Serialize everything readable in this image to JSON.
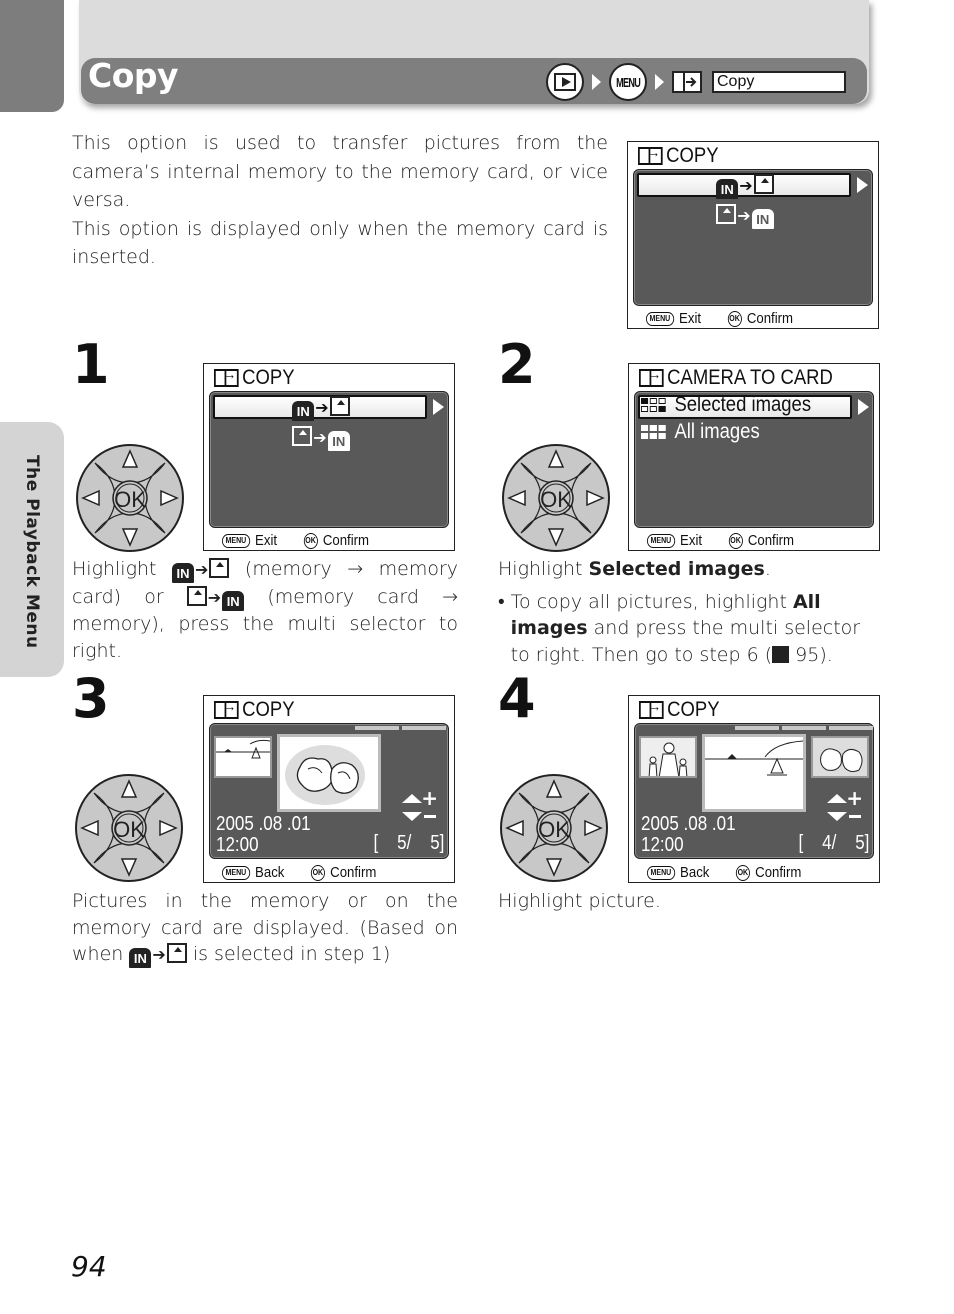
{
  "header": {
    "title": "Copy",
    "breadcrumb": {
      "steps": [
        {
          "icon": "playback-button-icon"
        },
        {
          "icon": "menu-button-icon",
          "label": "MENU"
        },
        {
          "icon": "copy-icon"
        }
      ],
      "field_value": "Copy"
    }
  },
  "side_tab": {
    "label": "The Playback Menu"
  },
  "intro": {
    "paragraphs": [
      "This option is used to transfer pictures from the camera’s internal memory to the memory card, or vice versa.",
      "This option is displayed only when the memory card is inserted."
    ]
  },
  "screens": {
    "intro": {
      "title": "COPY",
      "options": [
        {
          "from": "IN",
          "to": "card",
          "selected": true
        },
        {
          "from": "card",
          "to": "IN",
          "selected": false
        }
      ],
      "footer": {
        "menu_label": "MENU",
        "exit": "Exit",
        "ok_label": "OK",
        "confirm": "Confirm"
      }
    },
    "step1": {
      "title": "COPY",
      "options": [
        {
          "from": "IN",
          "to": "card",
          "selected": true
        },
        {
          "from": "card",
          "to": "IN",
          "selected": false
        }
      ],
      "footer": {
        "menu_label": "MENU",
        "exit": "Exit",
        "ok_label": "OK",
        "confirm": "Confirm"
      }
    },
    "step2": {
      "title": "CAMERA TO CARD",
      "options": [
        {
          "label": "Selected images",
          "icon": "selected-images-icon",
          "selected": true
        },
        {
          "label": "All images",
          "icon": "all-images-icon",
          "selected": false
        }
      ],
      "footer": {
        "menu_label": "MENU",
        "exit": "Exit",
        "ok_label": "OK",
        "confirm": "Confirm"
      }
    },
    "step3": {
      "title": "COPY",
      "date": "2005 .08 .01",
      "time": "12:00",
      "counter_current": "5/",
      "counter_total": "5",
      "footer": {
        "menu_label": "MENU",
        "back": "Back",
        "ok_label": "OK",
        "confirm": "Confirm"
      }
    },
    "step4": {
      "title": "COPY",
      "date": "2005 .08 .01",
      "time": "12:00",
      "counter_current": "4/",
      "counter_total": "5",
      "footer": {
        "menu_label": "MENU",
        "back": "Back",
        "ok_label": "OK",
        "confirm": "Confirm"
      }
    }
  },
  "dial": {
    "center_label": "OK"
  },
  "steps": [
    {
      "number": "1",
      "text_parts": [
        "Highlight",
        "(memory → memory card) or",
        "(memory card → memory), press the multi selector to right."
      ]
    },
    {
      "number": "2",
      "text_lead": "Highlight ",
      "text_bold": "Selected images",
      "text_tail": ".",
      "bullet": {
        "pre": "To copy all pictures, highlight ",
        "bold": "All images",
        "post": " and press the multi selector to right. Then go to step 6 (",
        "ref_page": "95",
        "end": ")."
      }
    },
    {
      "number": "3",
      "text": "Pictures in the memory or on the memory card are displayed. (Based on when",
      "text_tail": "is selected in step 1)"
    },
    {
      "number": "4",
      "text": "Highlight picture."
    }
  ],
  "page_number": "94"
}
